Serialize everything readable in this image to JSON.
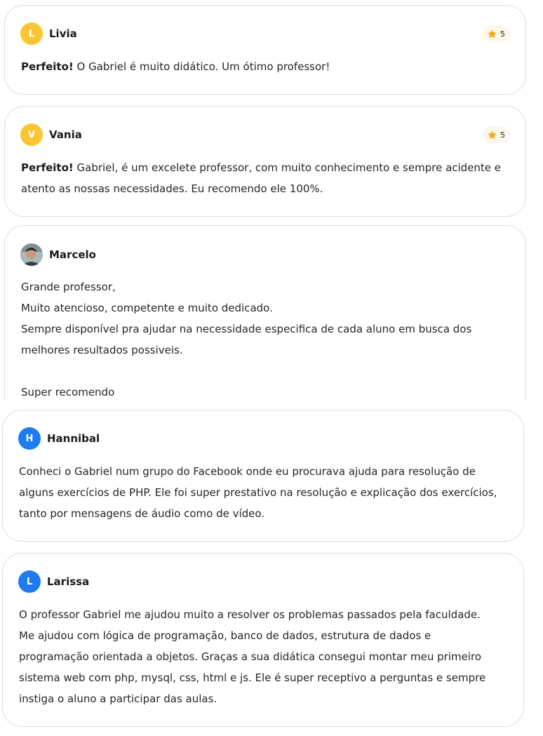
{
  "reviews": [
    {
      "author": "Livia",
      "initial": "L",
      "avatar_color": "#f9c532",
      "rating": "5",
      "highlight": "Perfeito!",
      "lines": [
        "O Gabriel é muito didático. Um ótimo professor!"
      ]
    },
    {
      "author": "Vania",
      "initial": "V",
      "avatar_color": "#f9c532",
      "rating": "5",
      "highlight": "Perfeito!",
      "lines": [
        "Gabriel, é um excelete professor, com muito conhecimento e sempre acidente e",
        "atento as nossas necessidades. Eu recomendo ele 100%."
      ]
    },
    {
      "author": "Marcelo",
      "avatar": "photo-avatar",
      "lines": [
        "Grande professor,",
        "Muito atencioso, competente e muito dedicado.",
        "Sempre disponível pra ajudar na necessidade especifica de cada aluno em busca dos",
        "melhores resultados possiveis.",
        "",
        "Super recomendo"
      ]
    },
    {
      "author": "Hannibal",
      "initial": "H",
      "avatar_color": "#1e7bf0",
      "lines": [
        "Conheci o Gabriel num grupo do Facebook onde eu procurava ajuda para resolução de",
        "alguns exercícios de PHP. Ele foi super prestativo na resolução e explicação dos exercícios,",
        "tanto por mensagens de áudio como de vídeo."
      ]
    },
    {
      "author": "Larissa",
      "initial": "L",
      "avatar_color": "#1e7bf0",
      "lines": [
        "O professor Gabriel me ajudou muito a resolver os problemas passados pela faculdade.",
        "Me ajudou com lógica de programação, banco de dados, estrutura de dados e",
        "programação orientada a objetos. Graças a sua didática consegui montar meu primeiro",
        "sistema web com php, mysql, css, html e js. Ele é super receptivo a perguntas e sempre",
        "instiga o aluno a participar das aulas."
      ]
    }
  ],
  "colors": {
    "star": "#f5a70b",
    "rating_bg": "#fdf6ea",
    "card_border": "#dcdcdc"
  }
}
